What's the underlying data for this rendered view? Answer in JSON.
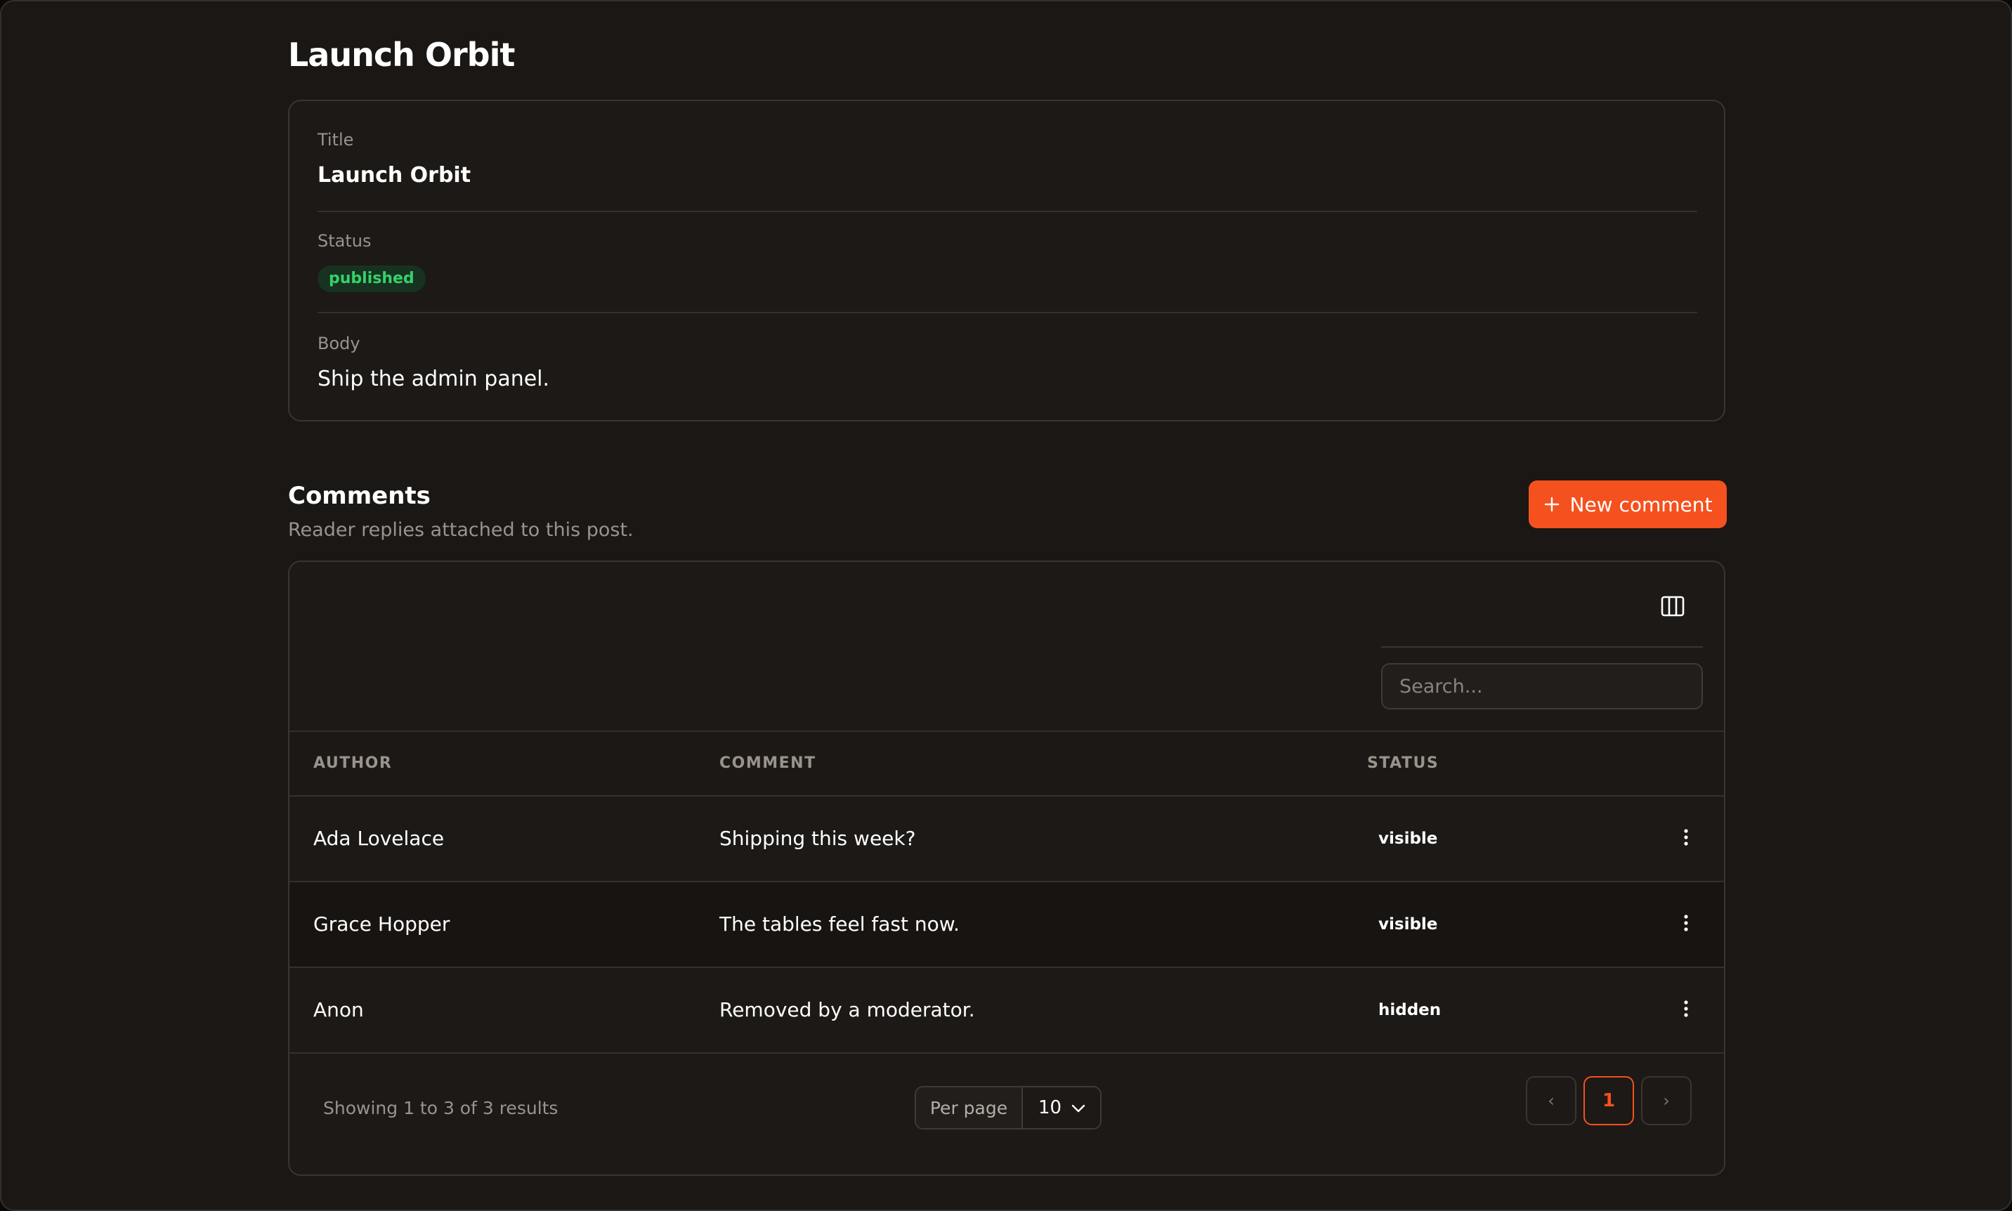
{
  "page": {
    "title": "Launch Orbit"
  },
  "detail": {
    "title_label": "Title",
    "title_value": "Launch Orbit",
    "status_label": "Status",
    "status_value": "published",
    "body_label": "Body",
    "body_value": "Ship the admin panel."
  },
  "comments": {
    "title": "Comments",
    "subtitle": "Reader replies attached to this post.",
    "new_button_label": "New comment",
    "search_placeholder": "Search...",
    "columns": {
      "author": "AUTHOR",
      "comment": "COMMENT",
      "status": "STATUS"
    },
    "rows": [
      {
        "author": "Ada Lovelace",
        "comment": "Shipping this week?",
        "status": "visible"
      },
      {
        "author": "Grace Hopper",
        "comment": "The tables feel fast now.",
        "status": "visible"
      },
      {
        "author": "Anon",
        "comment": "Removed by a moderator.",
        "status": "hidden"
      }
    ],
    "footer": {
      "results_text": "Showing 1 to 3 of 3 results",
      "per_page_label": "Per page",
      "per_page_value": "10",
      "prev_label": "‹",
      "current_page": "1",
      "next_label": "›"
    }
  },
  "icons": {
    "new_button": "plus-icon",
    "columns_toggle": "columns-icon",
    "row_actions": "vertical-ellipsis-icon",
    "per_page_dropdown": "chevron-down-icon"
  },
  "colors": {
    "accent": "#f4511e",
    "published_badge_text": "#34d26a",
    "published_badge_bg": "#173220",
    "background": "#1b1714"
  }
}
